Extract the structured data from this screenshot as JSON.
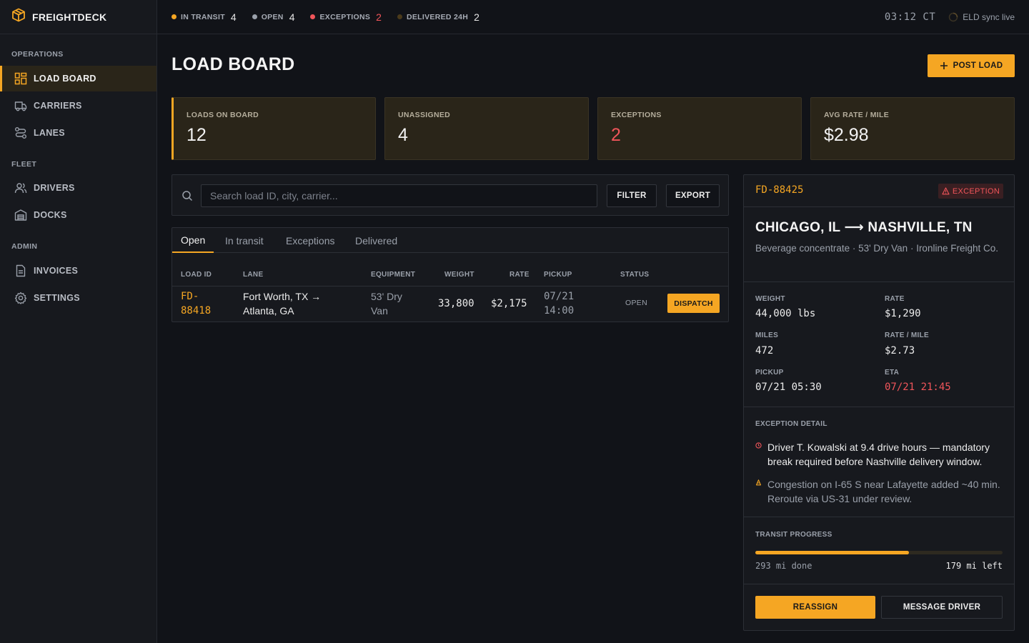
{
  "app": {
    "name": "FREIGHTDECK"
  },
  "sidebar": {
    "sections": [
      {
        "title": "OPERATIONS",
        "items": [
          {
            "label": "LOAD BOARD",
            "icon": "grid-icon",
            "active": true
          },
          {
            "label": "CARRIERS",
            "icon": "truck-icon"
          },
          {
            "label": "LANES",
            "icon": "route-icon"
          }
        ]
      },
      {
        "title": "FLEET",
        "items": [
          {
            "label": "DRIVERS",
            "icon": "users-icon"
          },
          {
            "label": "DOCKS",
            "icon": "warehouse-icon"
          }
        ]
      },
      {
        "title": "ADMIN",
        "items": [
          {
            "label": "INVOICES",
            "icon": "document-icon"
          },
          {
            "label": "SETTINGS",
            "icon": "gear-icon"
          }
        ]
      }
    ]
  },
  "topbar": {
    "stats": [
      {
        "label": "IN TRANSIT",
        "count": "4",
        "color": "#f5a623"
      },
      {
        "label": "OPEN",
        "count": "4",
        "color": "#9aa0aa"
      },
      {
        "label": "EXCEPTIONS",
        "count": "2",
        "color": "#f0555a"
      },
      {
        "label": "DELIVERED 24H",
        "count": "2",
        "color": "#4a3a1a"
      }
    ],
    "clock": "03:12 CT",
    "eld_status": "ELD sync live"
  },
  "main": {
    "title": "LOAD BOARD",
    "post_load_label": "POST LOAD",
    "kpis": [
      {
        "label": "LOADS ON BOARD",
        "value": "12"
      },
      {
        "label": "UNASSIGNED",
        "value": "4"
      },
      {
        "label": "EXCEPTIONS",
        "value": "2"
      },
      {
        "label": "AVG RATE / MILE",
        "value": "$2.98"
      }
    ],
    "search": {
      "placeholder": "Search load ID, city, carrier...",
      "filter_label": "FILTER",
      "export_label": "EXPORT"
    },
    "tabs": [
      "Open",
      "In transit",
      "Exceptions",
      "Delivered"
    ],
    "active_tab": "Open",
    "table": {
      "columns": [
        "LOAD ID",
        "LANE",
        "EQUIPMENT",
        "WEIGHT",
        "RATE",
        "PICKUP",
        "STATUS"
      ],
      "rows": [
        {
          "id_1": "FD-",
          "id_2": "88418",
          "lane_1": "Fort Worth, TX →",
          "lane_2": "Atlanta, GA",
          "equip_1": "53' Dry",
          "equip_2": "Van",
          "weight": "33,800",
          "rate": "$2,175",
          "pickup_1": "07/21",
          "pickup_2": "14:00",
          "status": "OPEN",
          "action": "DISPATCH"
        }
      ]
    }
  },
  "detail": {
    "load_id": "FD-88425",
    "badge": "EXCEPTION",
    "route": "CHICAGO, IL ⟶ NASHVILLE, TN",
    "subtitle": "Beverage concentrate · 53' Dry Van · Ironline Freight Co.",
    "metrics": {
      "weight_label": "WEIGHT",
      "weight": "44,000 lbs",
      "rate_label": "RATE",
      "rate": "$1,290",
      "miles_label": "MILES",
      "miles": "472",
      "rpm_label": "RATE / MILE",
      "rpm": "$2.73",
      "pickup_label": "PICKUP",
      "pickup": "07/21 05:30",
      "eta_label": "ETA",
      "eta": "07/21 21:45"
    },
    "exception_title": "EXCEPTION DETAIL",
    "exceptions": [
      {
        "text": "Driver T. Kowalski at 9.4 drive hours — mandatory break required before Nashville delivery window.",
        "severity": "critical"
      },
      {
        "text": "Congestion on I-65 S near Lafayette added ~40 min. Reroute via US-31 under review.",
        "severity": "warning"
      }
    ],
    "progress": {
      "title": "TRANSIT PROGRESS",
      "done_label": "293 mi done",
      "left_label": "179 mi left",
      "fraction": 0.62
    },
    "reassign_label": "REASSIGN",
    "message_label": "MESSAGE DRIVER"
  },
  "colors": {
    "accent": "#f5a623",
    "danger": "#f0555a",
    "bg": "#111318",
    "panel": "#17191e"
  }
}
